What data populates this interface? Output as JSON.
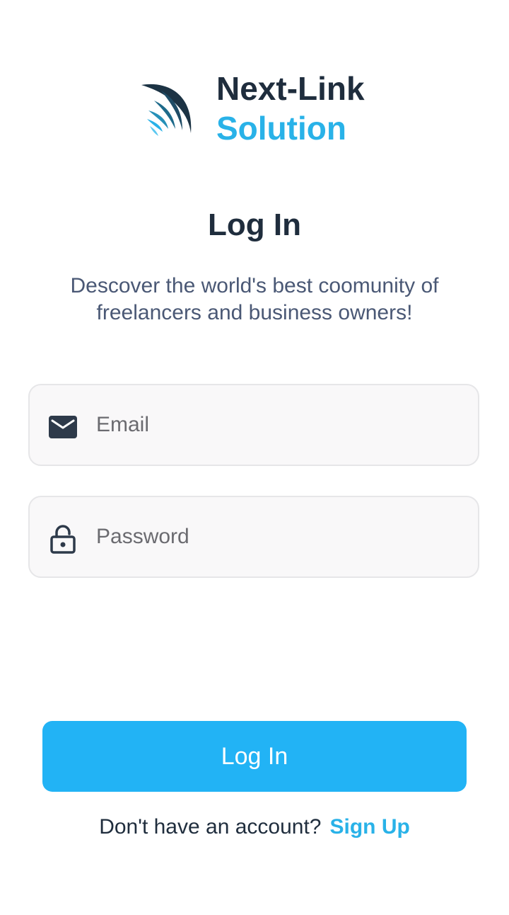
{
  "brand": {
    "name": "Next-Link",
    "sub": "Solution",
    "logo_icon": "wing-logo-icon",
    "colors": {
      "dark": "#1f2d3d",
      "accent": "#29b2e8"
    }
  },
  "page": {
    "title": "Log In",
    "subtitle": "Descover the world's best coomunity of freelancers and business owners!"
  },
  "form": {
    "email": {
      "icon": "mail-icon",
      "placeholder": "Email",
      "value": ""
    },
    "password": {
      "icon": "lock-icon",
      "placeholder": "Password",
      "value": ""
    },
    "submit_label": "Log In",
    "submit_color": "#22b3f5"
  },
  "footer": {
    "prompt": "Don't have an account?",
    "signup_label": "Sign Up"
  }
}
